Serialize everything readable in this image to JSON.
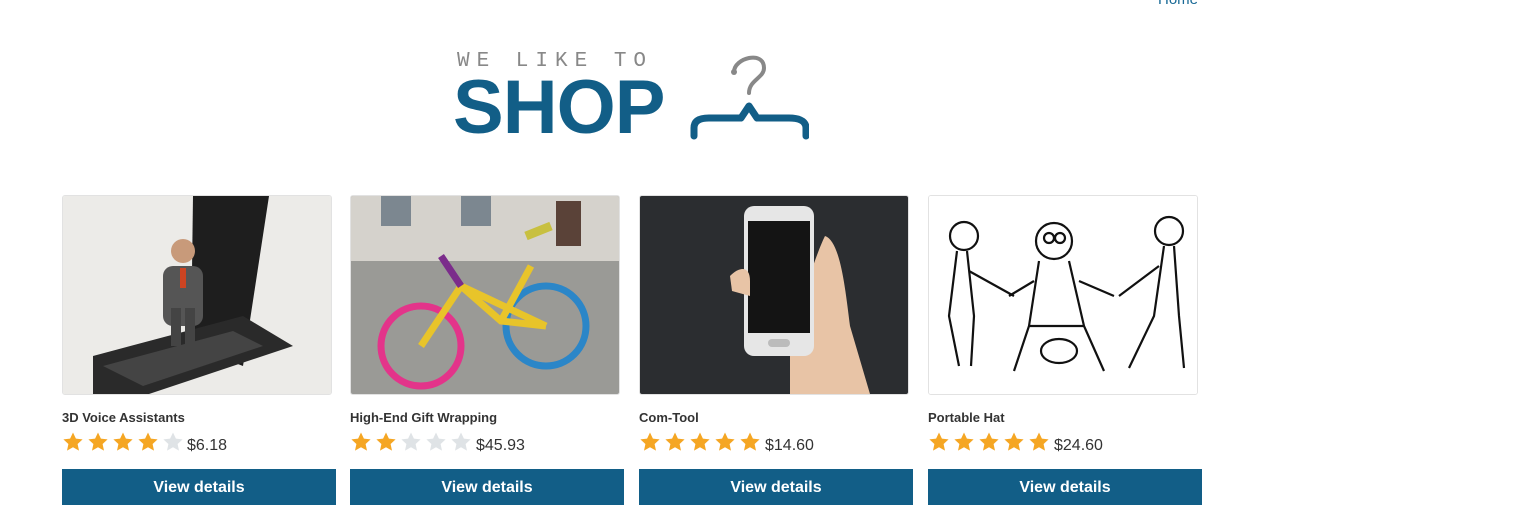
{
  "header": {
    "home_link": "Home",
    "logo_small": "WE LIKE TO",
    "logo_big": "SHOP"
  },
  "colors": {
    "brand": "#125e87",
    "star_filled": "#f5a623",
    "star_empty": "#dfe3e6"
  },
  "products": [
    {
      "title": "3D Voice Assistants",
      "rating": 4,
      "max_rating": 5,
      "price": "$6.18",
      "button_label": "View details",
      "image": "figurine-on-flip-phone"
    },
    {
      "title": "High-End Gift Wrapping",
      "rating": 2,
      "max_rating": 5,
      "price": "$45.93",
      "button_label": "View details",
      "image": "yarn-bombed-bicycle"
    },
    {
      "title": "Com-Tool",
      "rating": 5,
      "max_rating": 5,
      "price": "$14.60",
      "button_label": "View details",
      "image": "hand-holding-smartphone"
    },
    {
      "title": "Portable Hat",
      "rating": 5,
      "max_rating": 5,
      "price": "$24.60",
      "button_label": "View details",
      "image": "cartoon-tug-of-war-sketch"
    }
  ]
}
